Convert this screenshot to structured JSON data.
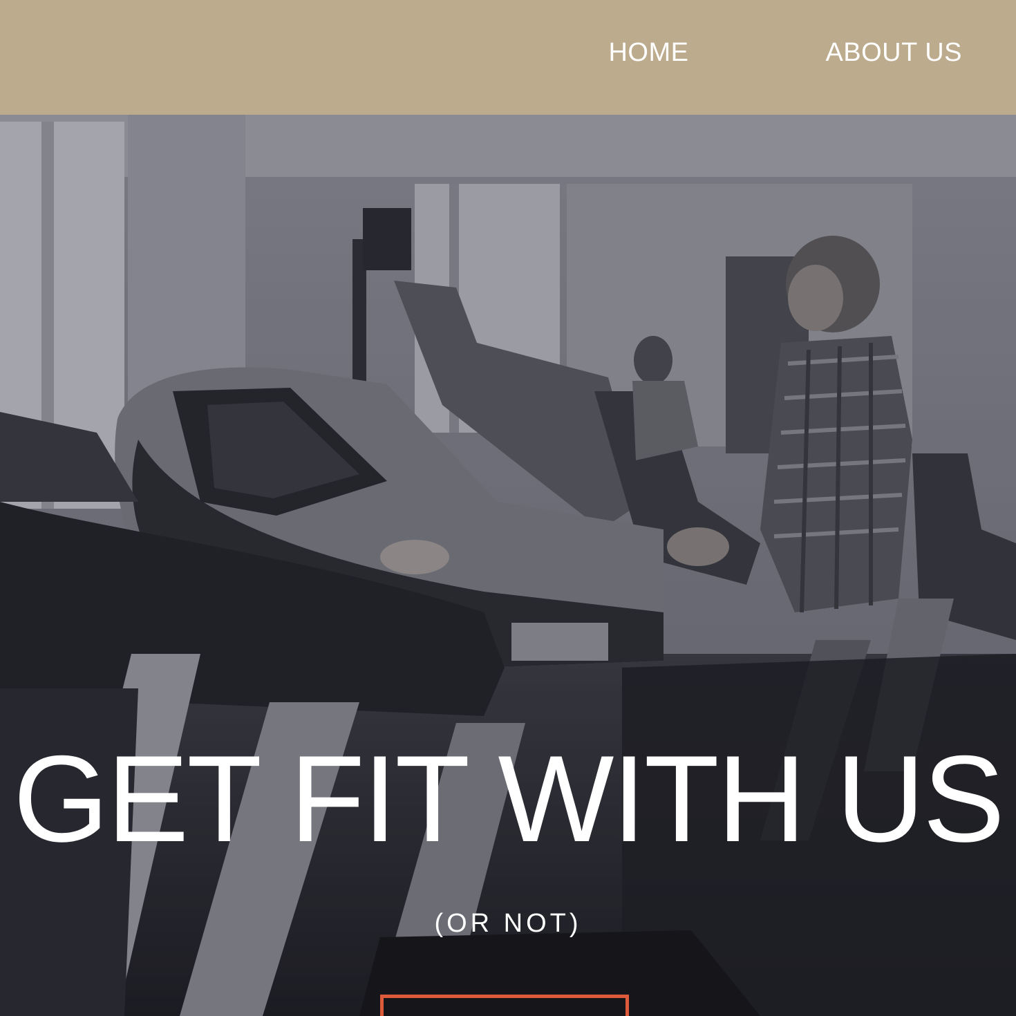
{
  "header": {
    "background": "#bcab8c",
    "nav": [
      {
        "label": "HOME"
      },
      {
        "label": "ABOUT US"
      }
    ]
  },
  "hero": {
    "background_photo": "gym-treadmills-photo",
    "title": "GET FIT WITH US",
    "subtitle": "(OR NOT)",
    "cta_border_color": "#dd5a3a"
  }
}
